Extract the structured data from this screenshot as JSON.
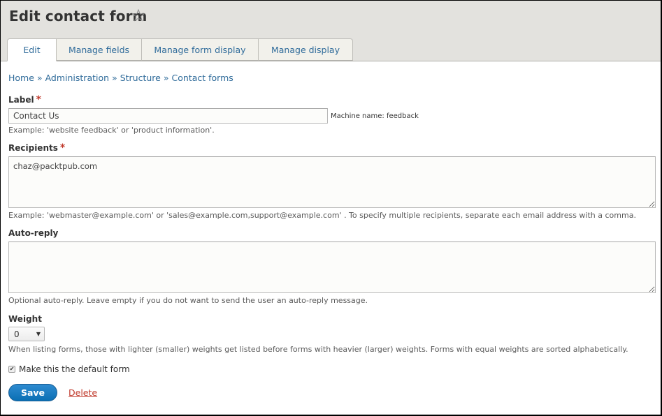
{
  "header": {
    "title": "Edit contact form",
    "star_icon": "star-outline-icon"
  },
  "tabs": [
    {
      "label": "Edit",
      "active": true
    },
    {
      "label": "Manage fields",
      "active": false
    },
    {
      "label": "Manage form display",
      "active": false
    },
    {
      "label": "Manage display",
      "active": false
    }
  ],
  "breadcrumb": {
    "items": [
      "Home",
      "Administration",
      "Structure",
      "Contact forms"
    ],
    "separator": "»"
  },
  "form": {
    "label": {
      "label": "Label",
      "required_marker": "*",
      "value": "Contact Us",
      "machine_name": "Machine name: feedback",
      "description": "Example: 'website feedback' or 'product information'."
    },
    "recipients": {
      "label": "Recipients",
      "required_marker": "*",
      "value": "chaz@packtpub.com",
      "description": "Example: 'webmaster@example.com' or 'sales@example.com,support@example.com' . To specify multiple recipients, separate each email address with a comma."
    },
    "auto_reply": {
      "label": "Auto-reply",
      "value": "",
      "description": "Optional auto-reply. Leave empty if you do not want to send the user an auto-reply message."
    },
    "weight": {
      "label": "Weight",
      "selected": "0",
      "description": "When listing forms, those with lighter (smaller) weights get listed before forms with heavier (larger) weights. Forms with equal weights are sorted alphabetically."
    },
    "default_form": {
      "label": "Make this the default form",
      "checked": true
    }
  },
  "actions": {
    "save_label": "Save",
    "delete_label": "Delete"
  },
  "colors": {
    "link": "#2f6b9a",
    "primary_button": "#0a6fb4",
    "danger": "#c0392b",
    "header_bg": "#e3e2de"
  }
}
